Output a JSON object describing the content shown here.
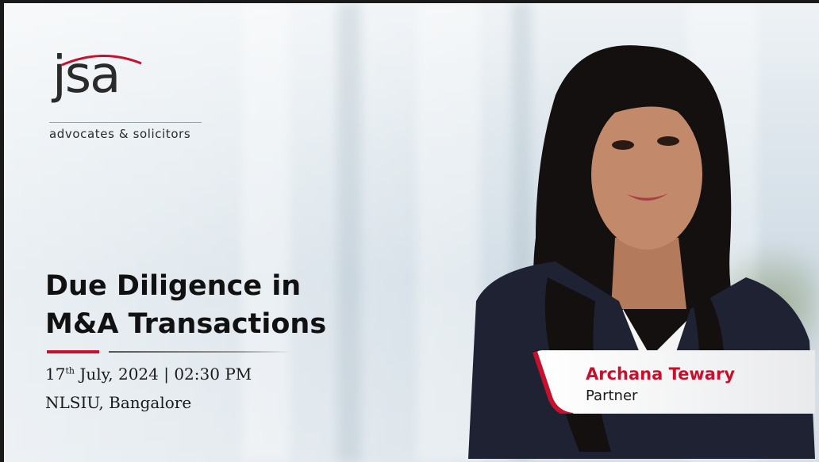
{
  "logo": {
    "mark": "jsa",
    "subtitle": "advocates & solicitors"
  },
  "event": {
    "title_line1": "Due Diligence in",
    "title_line2": "M&A Transactions",
    "date_day": "17",
    "date_suffix": "th",
    "date_rest": " July, 2024 | 02:30 PM",
    "venue": "NLSIU, Bangalore"
  },
  "speaker": {
    "name": "Archana Tewary",
    "role": "Partner"
  },
  "colors": {
    "accent": "#c8102e",
    "text": "#111111"
  }
}
